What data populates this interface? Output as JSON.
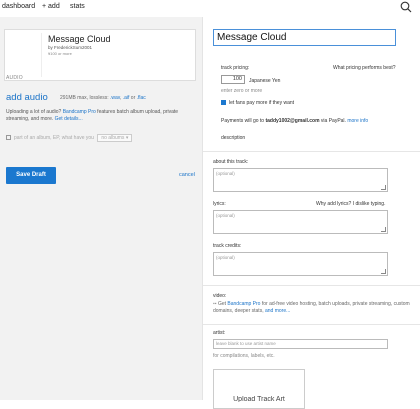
{
  "topbar": {
    "nav": [
      "dashboard",
      "+ add",
      "stats"
    ]
  },
  "left": {
    "card": {
      "title": "Message Cloud",
      "artist": "by FrederickSum2001",
      "price": "¥100 or more"
    },
    "audio_label": "AUDIO",
    "add_audio": "add audio",
    "formats": {
      "pre": "291MB max, lossless:",
      "wav": ".wav",
      "aif": ".aif",
      "or": "or",
      "flac": ".flac"
    },
    "bulk_note": {
      "pre": "Uploading a lot of audio? ",
      "bandcamp_pro": "Bandcamp Pro",
      "mid": " features batch album upload, private streaming, and more. ",
      "details": "Get details..."
    },
    "album_part": {
      "label": "part of an album, EP, what have you",
      "select": "no albums"
    },
    "save_label": "Save Draft",
    "cancel_label": "cancel"
  },
  "right": {
    "title_value": "Message Cloud",
    "track_pricing_label": "track pricing:",
    "what_pricing_link": "What pricing performs best?",
    "price_value": "100",
    "currency": "Japanese Yen",
    "price_hint": "enter zero or more",
    "let_fans_pay": "let fans pay more if they want",
    "payments": {
      "pre": "Payments will go to ",
      "email": "taddy1002@gmail.com",
      "mid": " via PayPal.",
      "more": "more info"
    },
    "description_link": "description",
    "about_label": "about this track:",
    "optional": "(optional)",
    "lyrics_label": "lyrics:",
    "lyrics_link": "Why add lyrics? I dislike typing.",
    "credits_label": "track credits:",
    "video": {
      "label": "video:",
      "pre": "Get ",
      "pro": "Bandcamp Pro",
      "mid": " for ad-free video hosting, batch uploads, private streaming, custom domains, deeper stats, ",
      "more": "and more..."
    },
    "artist": {
      "label": "artist:",
      "placeholder": "leave blank to use artist name",
      "hint": "for compilations, labels, etc."
    },
    "upload_label": "Upload Track Art"
  }
}
